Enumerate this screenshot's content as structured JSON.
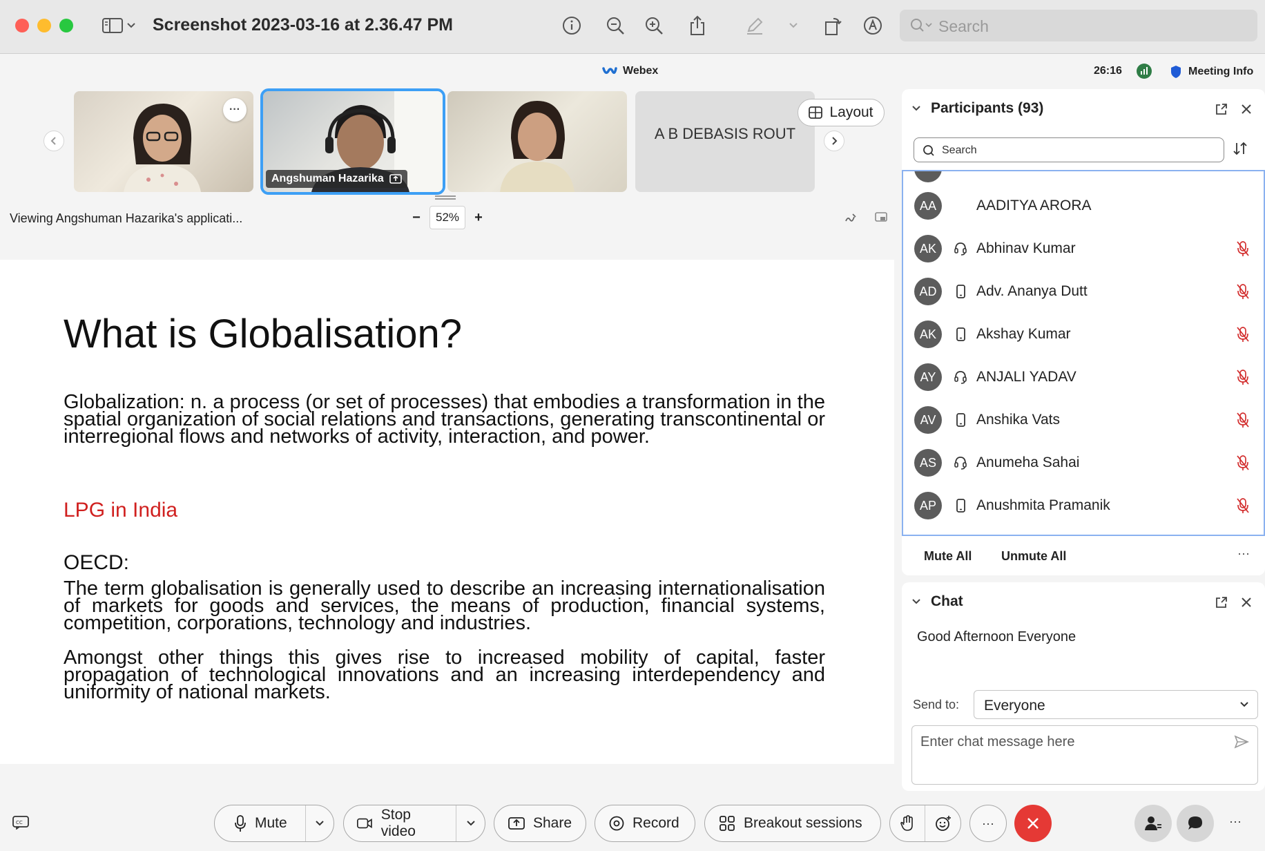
{
  "window": {
    "title": "Screenshot 2023-03-16 at 2.36.47 PM",
    "search_placeholder": "Search"
  },
  "webex": {
    "app_name": "Webex",
    "timer": "26:16",
    "meeting_info": "Meeting Info"
  },
  "video": {
    "tiles": [
      {
        "name": ""
      },
      {
        "name": "Angshuman Hazarika"
      },
      {
        "name": ""
      },
      {
        "name": "A B DEBASIS ROUT"
      }
    ],
    "layout_label": "Layout",
    "more_label": "···"
  },
  "share": {
    "viewing": "Viewing Angshuman Hazarika's applicati...",
    "zoom_minus": "−",
    "zoom_value": "52%",
    "zoom_plus": "+"
  },
  "slide": {
    "title": "What is Globalisation?",
    "definition": "Globalization: n. a process (or set of processes) that embodies a transformation in the spatial organization of social relations and transactions, generating transcontinental or interregional flows and networks of activity, interaction, and power.",
    "lpg_link": "LPG in India",
    "oecd_heading": "OECD:",
    "oecd_text": "The term globalisation is generally used to describe an increasing internationalisation of markets for goods and services, the means of production, financial systems, competition, corporations, technology and industries.",
    "oecd_text2": "Amongst other things this gives rise to increased mobility of capital, faster propagation of technological innovations and an increasing interdependency and uniformity of national markets."
  },
  "participants": {
    "header": "Participants (93)",
    "search_placeholder": "Search",
    "list": [
      {
        "initials": "AA",
        "name": "AADITYA ARORA",
        "device": "none"
      },
      {
        "initials": "AK",
        "name": "Abhinav Kumar",
        "device": "headset"
      },
      {
        "initials": "AD",
        "name": "Adv. Ananya Dutt",
        "device": "phone"
      },
      {
        "initials": "AK",
        "name": "Akshay Kumar",
        "device": "phone"
      },
      {
        "initials": "AY",
        "name": "ANJALI YADAV",
        "device": "headset"
      },
      {
        "initials": "AV",
        "name": "Anshika Vats",
        "device": "phone"
      },
      {
        "initials": "AS",
        "name": "Anumeha Sahai",
        "device": "headset"
      },
      {
        "initials": "AP",
        "name": "Anushmita Pramanik",
        "device": "phone"
      }
    ],
    "mute_all": "Mute All",
    "unmute_all": "Unmute All",
    "more": "···"
  },
  "chat": {
    "header": "Chat",
    "message": "Good Afternoon Everyone",
    "send_to_label": "Send to:",
    "send_to_value": "Everyone",
    "input_placeholder": "Enter chat message here"
  },
  "controls": {
    "mute": "Mute",
    "stop_video": "Stop video",
    "share": "Share",
    "record": "Record",
    "breakout": "Breakout sessions",
    "more": "···",
    "more_right": "···"
  },
  "colors": {
    "accent_blue": "#3d9ff5",
    "end_red": "#e53935",
    "slide_red": "#d0201f"
  }
}
